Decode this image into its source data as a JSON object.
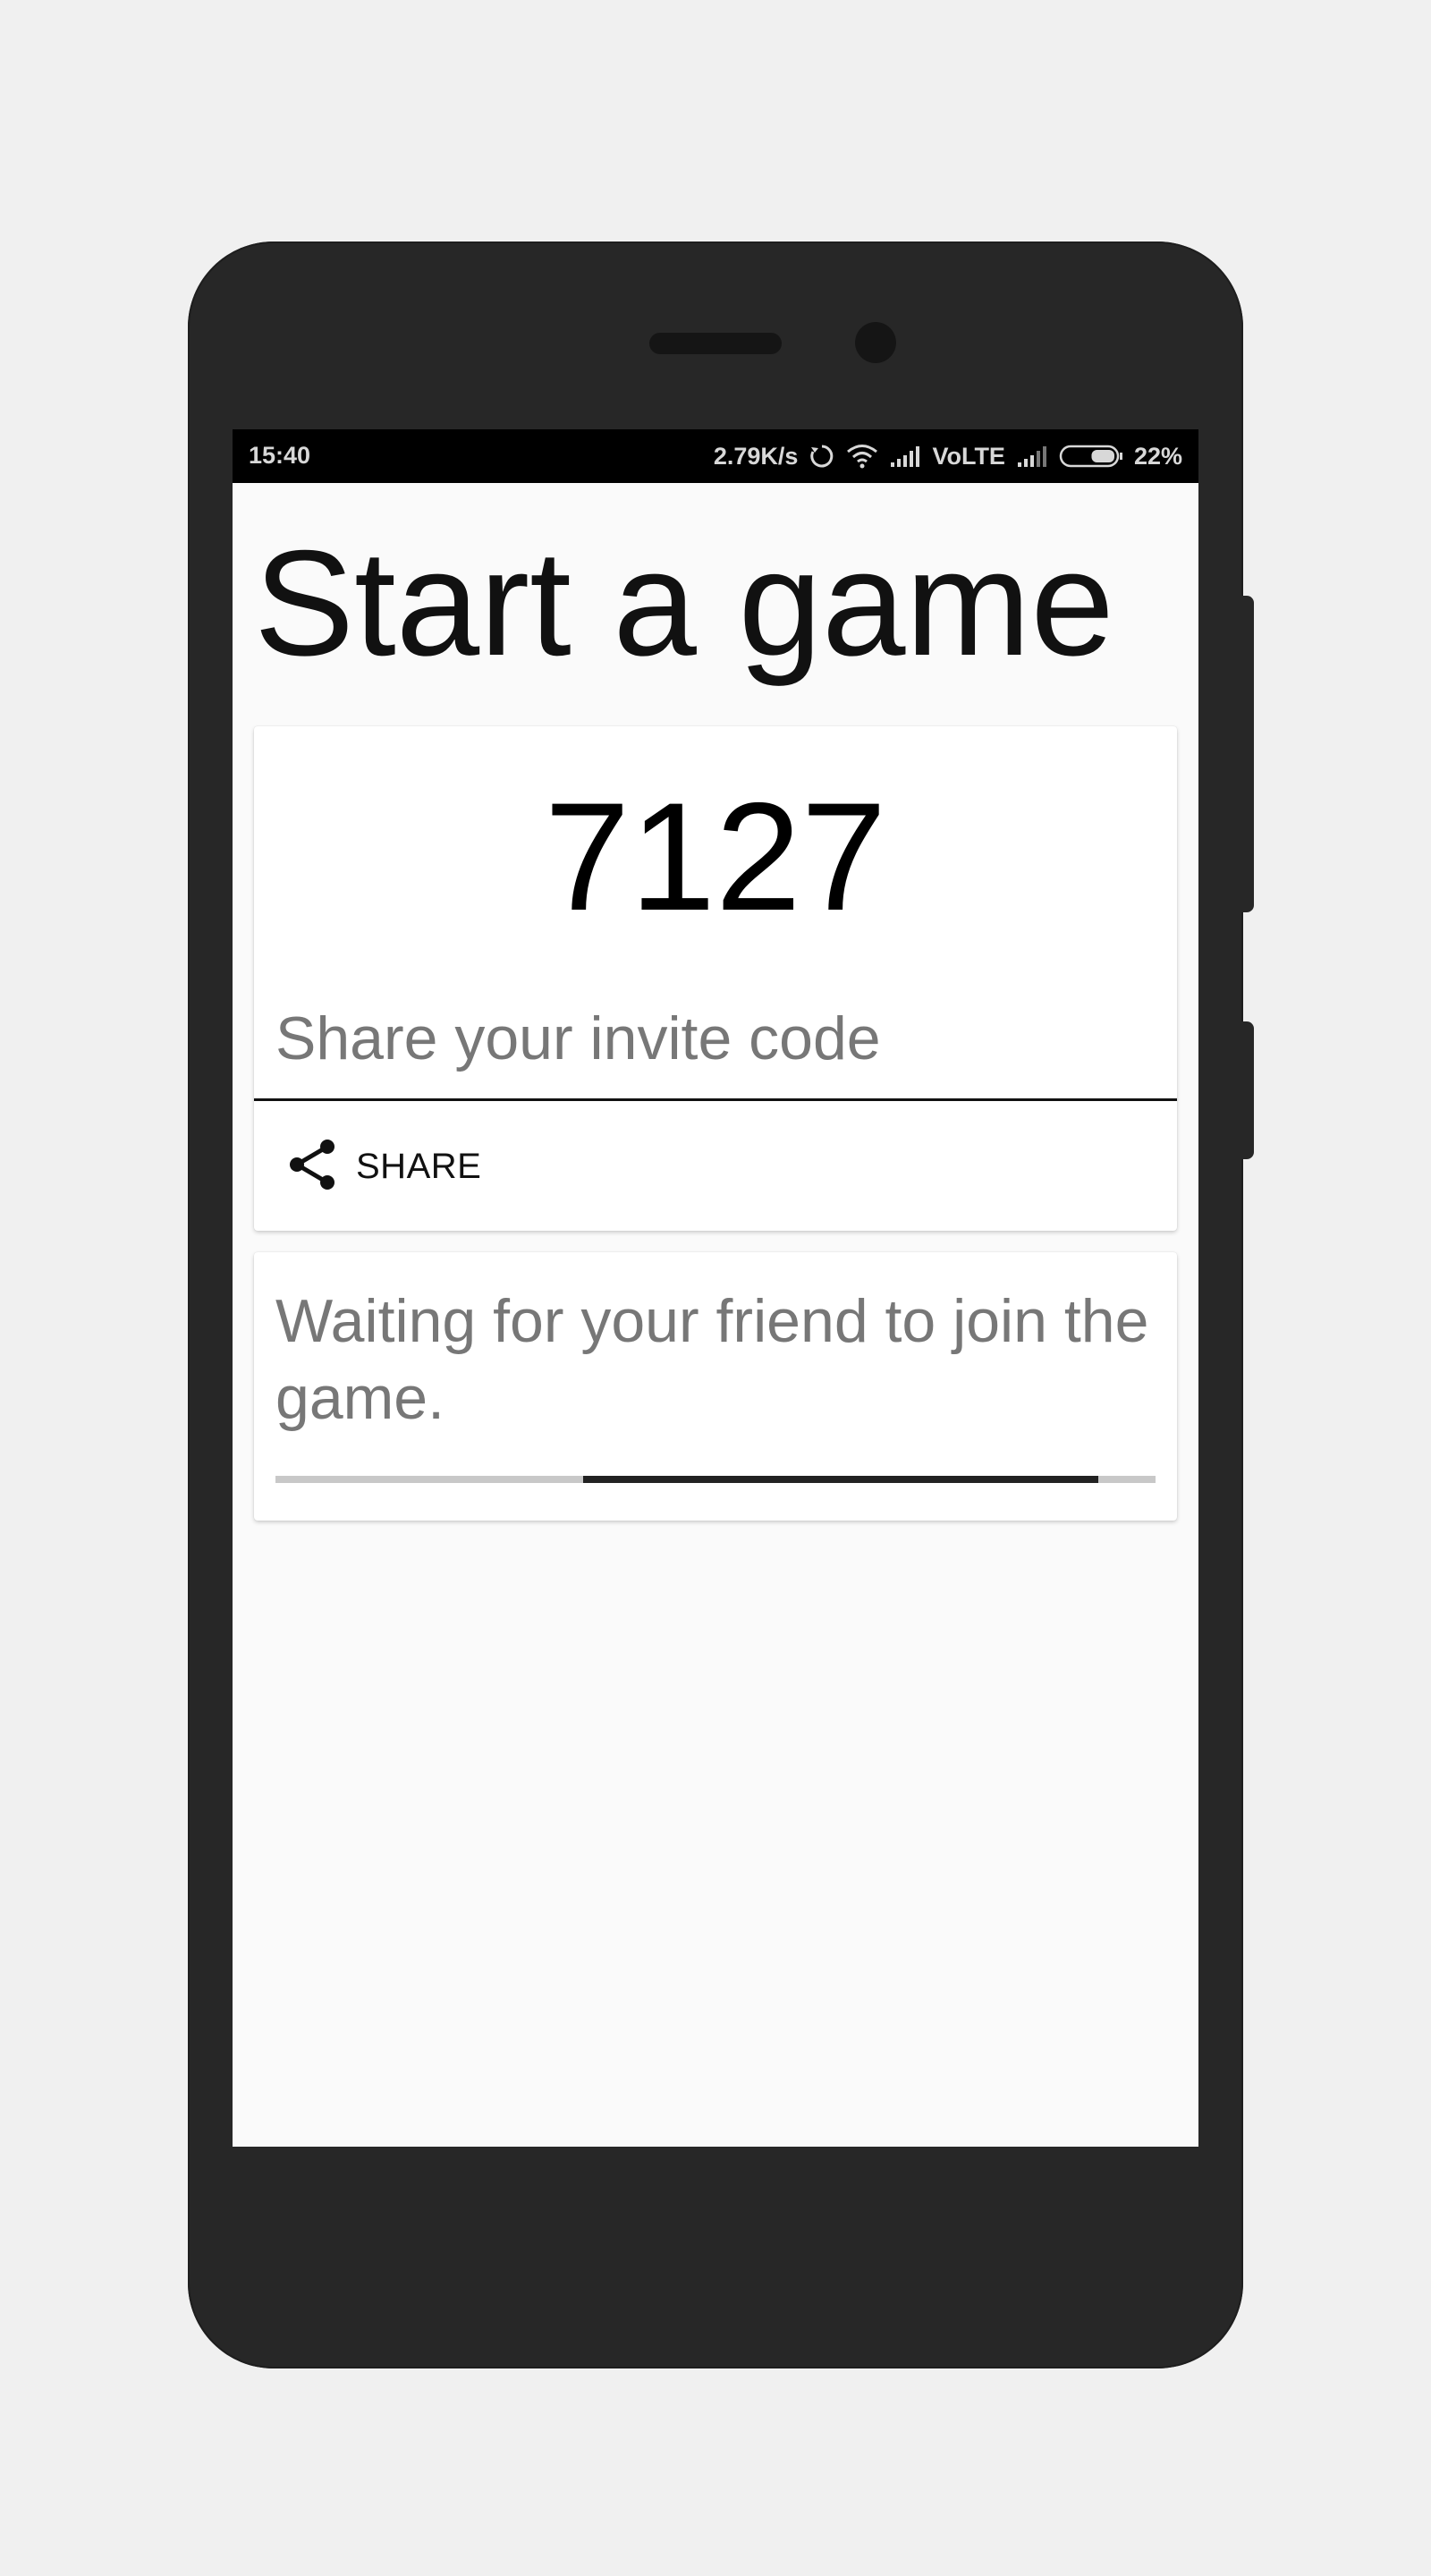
{
  "status_bar": {
    "time": "15:40",
    "network_speed": "2.79K/s",
    "carrier_label": "VoLTE",
    "battery_percent": "22%",
    "battery_level": 0.22,
    "icons": [
      "sync-icon",
      "wifi-icon",
      "signal-icon",
      "signal-icon",
      "battery-icon"
    ]
  },
  "page": {
    "title": "Start a game"
  },
  "invite_card": {
    "code": "7127",
    "label": "Share your invite code",
    "share_button": {
      "label": "SHARE",
      "icon": "share-icon"
    }
  },
  "waiting_card": {
    "message": "Waiting for your friend to join the game.",
    "progress": {
      "type": "indeterminate",
      "segment_start": 0.35,
      "segment_end": 0.935
    }
  },
  "colors": {
    "screen_background": "#fafafa",
    "status_bar": "#000000",
    "phone_frame": "#272727",
    "secondary_text": "#777777",
    "progress_track": "#c8c8c8",
    "progress_fill": "#222222"
  }
}
